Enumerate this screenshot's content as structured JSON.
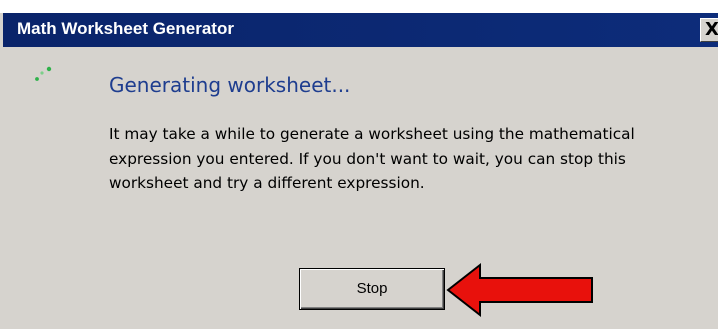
{
  "window": {
    "title": "Math Worksheet Generator",
    "close_label": "X"
  },
  "progress": {
    "heading": "Generating worksheet...",
    "message": "It may take a while to generate a worksheet using the mathematical expression you entered. If you don't want to wait, you can stop this worksheet and try a different expression.",
    "icon": "busy-spinner-icon"
  },
  "actions": {
    "stop_label": "Stop"
  },
  "annotation": {
    "icon": "red-arrow-icon",
    "color": "#e8110c"
  },
  "colors": {
    "titlebar": "#0a246a",
    "dialog_bg": "#d6d3ce",
    "heading": "#1e3d8f",
    "spinner": "#2fb24a"
  }
}
